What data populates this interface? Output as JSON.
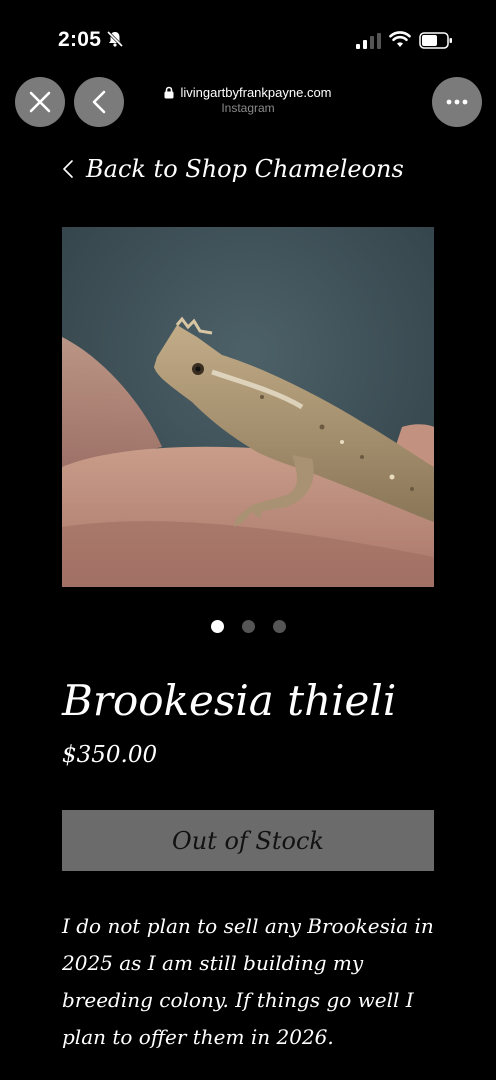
{
  "status_bar": {
    "time": "2:05"
  },
  "browser": {
    "url": "livingartbyfrankpayne.com",
    "source": "Instagram"
  },
  "nav": {
    "back_label": "Back to Shop Chameleons"
  },
  "product": {
    "title": "Brookesia thieli",
    "price": "$350.00",
    "stock_label": "Out of Stock",
    "description": "I do not plan to sell any Brookesia in 2025 as I am still building my breeding colony. If things go well I plan to offer them in 2026.",
    "image_count": 3,
    "active_image": 1
  },
  "colors": {
    "background": "#000000",
    "button_bg": "#6b6b6b",
    "circle_btn": "#7b7b7b"
  }
}
